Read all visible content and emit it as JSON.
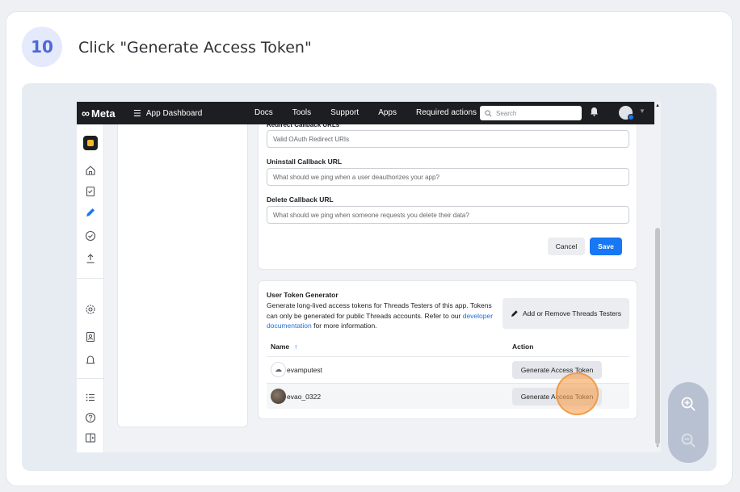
{
  "step": {
    "number": "10",
    "title": "Click \"Generate Access Token\""
  },
  "topbar": {
    "brand": "Meta",
    "app_dashboard": "App Dashboard",
    "nav": [
      "Docs",
      "Tools",
      "Support",
      "Apps",
      "Required actions"
    ],
    "search_placeholder": "Search"
  },
  "form": {
    "cut_label": "Redirect Callback URLs",
    "redirect_placeholder": "Valid OAuth Redirect URIs",
    "uninstall_label": "Uninstall Callback URL",
    "uninstall_placeholder": "What should we ping when a user deauthorizes your app?",
    "delete_label": "Delete Callback URL",
    "delete_placeholder": "What should we ping when someone requests you delete their data?",
    "cancel": "Cancel",
    "save": "Save"
  },
  "token_generator": {
    "title": "User Token Generator",
    "desc_before_link": "Generate long-lived access tokens for Threads Testers of this app. Tokens can only be generated for public Threads accounts. Refer to our ",
    "link": "developer documentation",
    "desc_after_link": " for more information.",
    "testers_button": "Add or Remove Threads Testers",
    "col_name": "Name",
    "col_action": "Action",
    "rows": [
      {
        "name": "evamputest",
        "action": "Generate Access Token"
      },
      {
        "name": "evao_0322",
        "action": "Generate Access Token"
      }
    ]
  },
  "colors": {
    "accent": "#1877f2",
    "badge_text": "#4d68d8",
    "click_marker": "#f7a050"
  }
}
